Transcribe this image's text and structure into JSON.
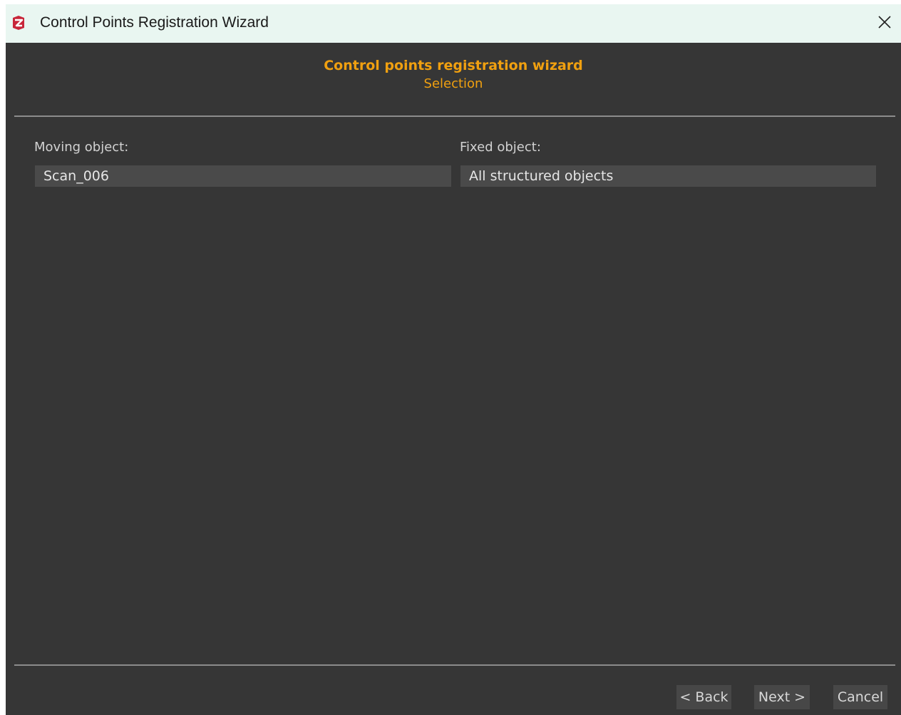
{
  "window": {
    "title": "Control Points Registration Wizard",
    "app_icon": "app-logo-icon",
    "close_icon": "close-icon"
  },
  "header": {
    "title": "Control points registration wizard",
    "subtitle": "Selection"
  },
  "moving": {
    "label": "Moving object:",
    "value": "Scan_006"
  },
  "fixed": {
    "label": "Fixed object:",
    "value": "All structured objects"
  },
  "footer": {
    "back_label": "< Back",
    "next_label": "Next >",
    "cancel_label": "Cancel"
  },
  "colors": {
    "accent": "#f0a010",
    "background": "#363636",
    "titlebar": "#e9f6f1",
    "field": "#4a4a4a",
    "icon_red": "#c8263a"
  }
}
